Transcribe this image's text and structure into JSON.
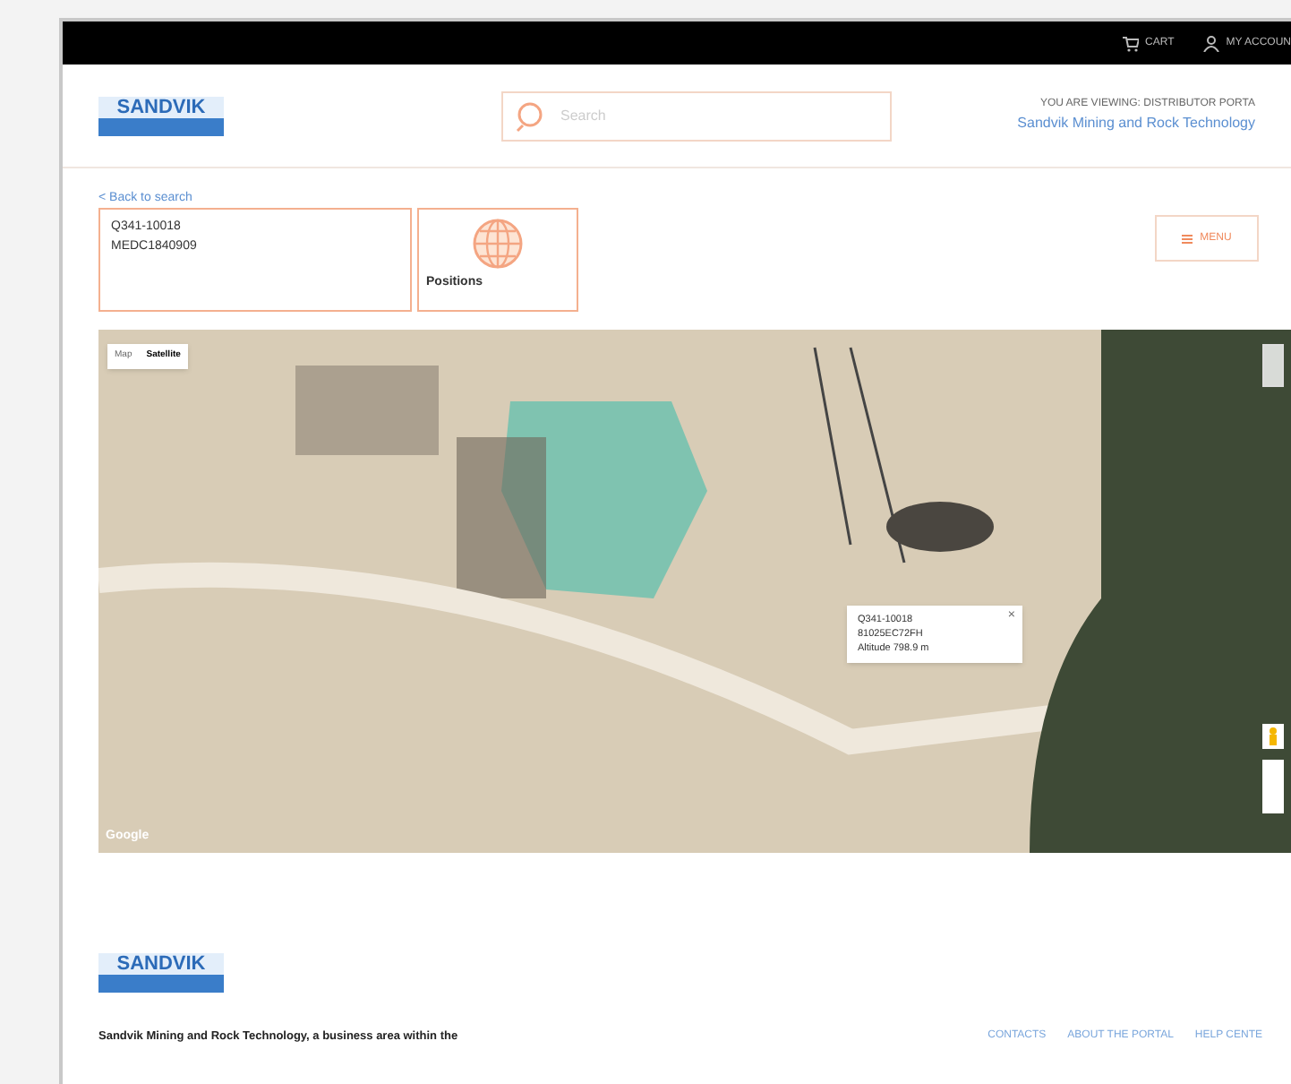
{
  "top_bar": {
    "links": [
      {
        "label": "CART"
      },
      {
        "label": "MY ACCOUN"
      }
    ]
  },
  "header": {
    "logo": "SANDVIK",
    "search": {
      "placeholder": "Search"
    },
    "viewing_label": "YOU ARE VIEWING: DISTRIBUTOR PORTA",
    "company_link": "Sandvik Mining and Rock Technology"
  },
  "back_link": "< Back to search",
  "machine": {
    "lines": [
      "Q341-10018",
      "MEDC1840909"
    ]
  },
  "positions_tile": {
    "label": "Positions"
  },
  "menu_button": {
    "label": "MENU"
  },
  "map": {
    "map_types": [
      {
        "label": "Map",
        "selected": false
      },
      {
        "label": "Satellite",
        "selected": true
      }
    ],
    "popup": {
      "lines": [
        "Q341-10018",
        "81025EC72FH",
        "Altitude 798.9 m"
      ],
      "close": "×"
    },
    "attribution": "Google"
  },
  "footer": {
    "logo": "SANDVIK",
    "text": "Sandvik Mining and Rock Technology, a business area within the",
    "links": [
      "CONTACTS",
      "ABOUT THE PORTAL",
      "HELP CENTE"
    ]
  }
}
